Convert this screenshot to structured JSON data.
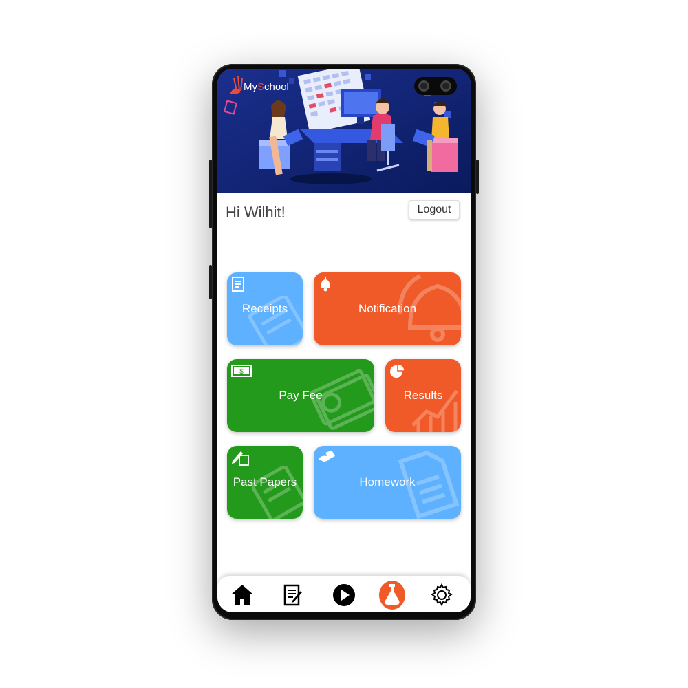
{
  "app": {
    "logo_prefix": "My",
    "logo_accent": "S",
    "logo_suffix": "chool"
  },
  "header": {
    "greeting": "Hi Wilhit!",
    "logout_label": "Logout"
  },
  "tiles": [
    {
      "id": "receipts",
      "label": "Receipts",
      "color": "#5eb1ff",
      "icon": "receipt-icon"
    },
    {
      "id": "notification",
      "label": "Notification",
      "color": "#f05a28",
      "icon": "bell-icon"
    },
    {
      "id": "pay-fee",
      "label": "Pay Fee",
      "color": "#249a1c",
      "icon": "money-icon"
    },
    {
      "id": "results",
      "label": "Results",
      "color": "#f05a28",
      "icon": "pie-chart-icon"
    },
    {
      "id": "past-papers",
      "label": "Past Papers",
      "color": "#249a1c",
      "icon": "pen-paper-icon"
    },
    {
      "id": "homework",
      "label": "Homework",
      "color": "#5eb1ff",
      "icon": "hand-paper-icon"
    }
  ],
  "bottom_nav": [
    {
      "id": "home",
      "icon": "home-icon",
      "active": false
    },
    {
      "id": "documents",
      "icon": "document-edit-icon",
      "active": false
    },
    {
      "id": "play",
      "icon": "play-icon",
      "active": false
    },
    {
      "id": "lab",
      "icon": "flask-icon",
      "active": true
    },
    {
      "id": "settings",
      "icon": "gear-icon",
      "active": false
    }
  ],
  "colors": {
    "accent_orange": "#f05a28",
    "blue_tile": "#5eb1ff",
    "green_tile": "#249a1c",
    "banner_blue": "#0d2272"
  }
}
